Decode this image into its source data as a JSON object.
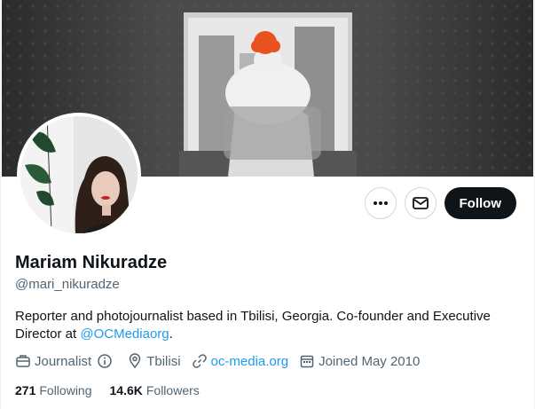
{
  "profile": {
    "name": "Mariam Nikuradze",
    "handle": "@mari_nikuradze",
    "bio_text": "Reporter and photojournalist based in Tbilisi, Georgia. Co-founder and Executive Director at ",
    "bio_mention": "@OCMediaorg",
    "bio_end": "."
  },
  "actions": {
    "more_icon": "more-icon",
    "message_icon": "envelope-icon",
    "follow_label": "Follow"
  },
  "meta": {
    "profession": "Journalist",
    "location": "Tbilisi",
    "website": "oc-media.org",
    "joined": "Joined May 2010"
  },
  "stats": {
    "following_count": "271",
    "following_label": "Following",
    "followers_count": "14.6K",
    "followers_label": "Followers"
  },
  "colors": {
    "accent": "#1d9bf0",
    "text": "#0f1419",
    "secondary": "#536471",
    "button_dark": "#0f1419"
  }
}
